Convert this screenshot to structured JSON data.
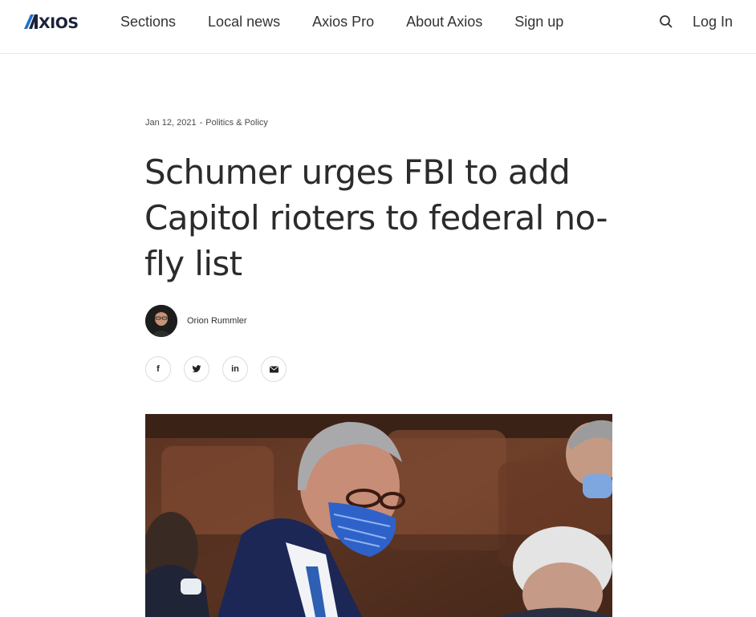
{
  "header": {
    "logo": "AXIOS",
    "nav": [
      "Sections",
      "Local news",
      "Axios Pro",
      "About Axios",
      "Sign up"
    ],
    "search_icon": "search-icon",
    "login_label": "Log In"
  },
  "article": {
    "date": "Jan 12, 2021",
    "separator": "-",
    "category": "Politics & Policy",
    "headline": "Schumer urges FBI to add Capitol rioters to federal no-fly list",
    "author": "Orion Rummler",
    "share": [
      {
        "icon": "facebook-icon",
        "glyph": "f"
      },
      {
        "icon": "twitter-icon",
        "glyph": "t"
      },
      {
        "icon": "linkedin-icon",
        "glyph": "in"
      },
      {
        "icon": "email-icon",
        "glyph": "✉"
      }
    ]
  },
  "colors": {
    "brand_dark": "#1c2239",
    "brand_accent": "#1f6fcf",
    "text": "#2b2b2b",
    "divider": "#e9e9e9"
  }
}
